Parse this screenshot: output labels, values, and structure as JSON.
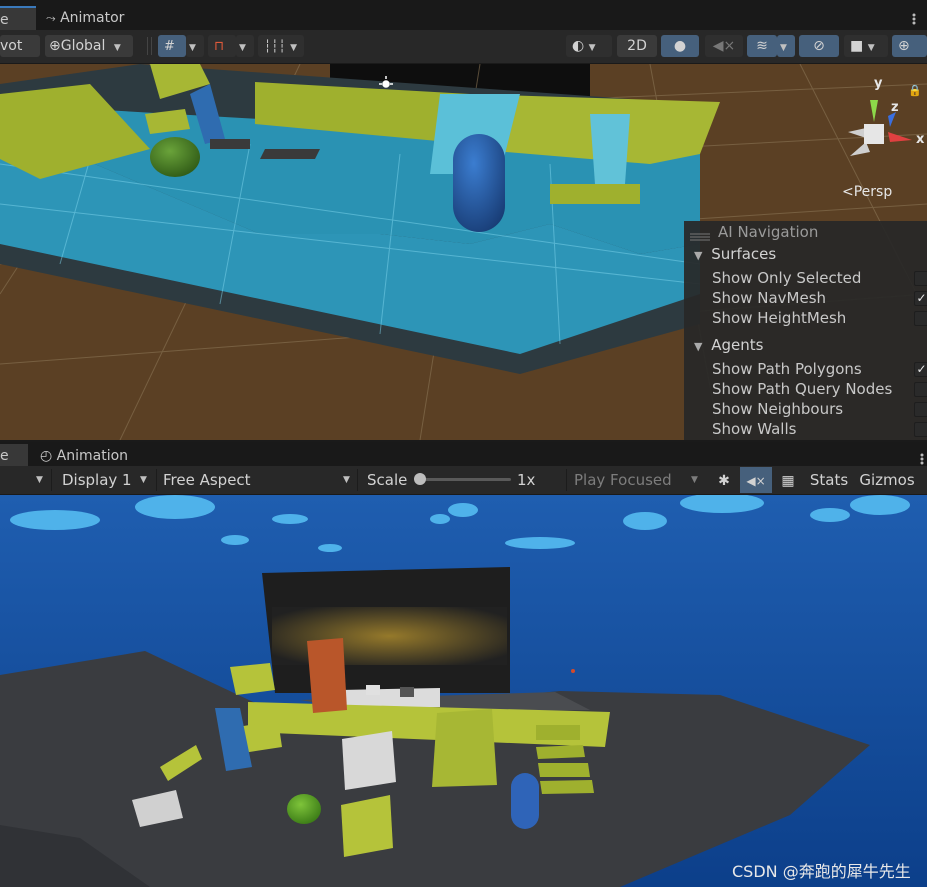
{
  "scene_tabs": {
    "scene_tab_label": "e",
    "animator_tab_label": "Animator"
  },
  "toolbar": {
    "pivot_label": "vot",
    "global_label": "Global",
    "mode_2d_label": "2D"
  },
  "gizmo": {
    "x_label": "x",
    "y_label": "y",
    "z_label": "z",
    "persp_label": "Persp"
  },
  "ai_navigation": {
    "title": "AI Navigation",
    "surfaces_header": "Surfaces",
    "surfaces_items": [
      {
        "label": "Show Only Selected",
        "checked": false
      },
      {
        "label": "Show NavMesh",
        "checked": true
      },
      {
        "label": "Show HeightMesh",
        "checked": false
      }
    ],
    "agents_header": "Agents",
    "agents_items": [
      {
        "label": "Show Path Polygons",
        "checked": true
      },
      {
        "label": "Show Path Query Nodes",
        "checked": false
      },
      {
        "label": "Show Neighbours",
        "checked": false
      },
      {
        "label": "Show Walls",
        "checked": false
      }
    ],
    "check_mark": "✓"
  },
  "game_tabs": {
    "game_tab_label": "e",
    "animation_tab_label": "Animation"
  },
  "game_bar": {
    "display_label": "Display 1",
    "aspect_label": "Free Aspect",
    "scale_label": "Scale",
    "scale_value": "1x",
    "play_mode_label": "Play Focused",
    "stats_label": "Stats",
    "gizmos_label": "Gizmos"
  },
  "watermark": "CSDN @奔跑的犀牛先生"
}
